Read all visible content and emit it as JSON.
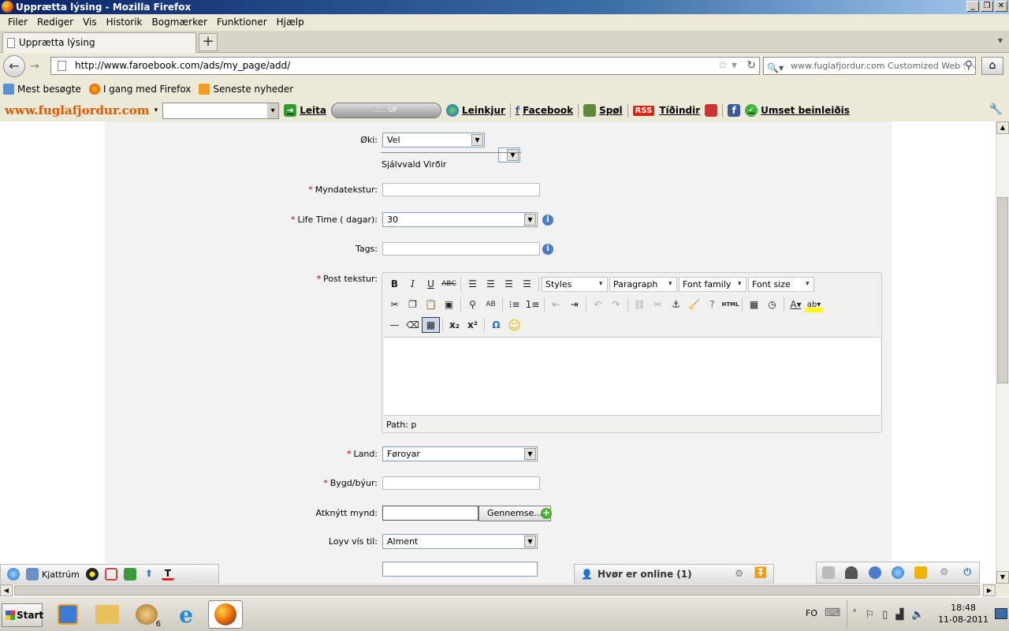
{
  "window": {
    "title": "Upprætta lýsing - Mozilla Firefox"
  },
  "menu": {
    "items": [
      "Filer",
      "Rediger",
      "Vis",
      "Historik",
      "Bogmærker",
      "Funktioner",
      "Hjælp"
    ]
  },
  "tab": {
    "title": "Upprætta lýsing"
  },
  "nav": {
    "url": "http://www.faroebook.com/ads/my_page/add/",
    "search_text": "www.fuglafjordur.com Customized Web Sear"
  },
  "bookmarks": [
    "Mest besøgte",
    "I gang med Firefox",
    "Seneste nyheder"
  ],
  "custom_toolbar": {
    "brand": "www.fuglafjordur.com",
    "search_button": "Leita",
    "player_text": "..... UF",
    "links_button": "Leinkjur",
    "facebook_button": "Facebook",
    "games_button": "Spøl",
    "rss_badge": "RSS",
    "news_button": "Tíðindir",
    "misc_button": "Umset beinleiðis"
  },
  "form": {
    "area_label": "Øki:",
    "area_value": "Vel",
    "optional_note": "Sjálvvald Virðir",
    "caption_label": "Myndatekstur:",
    "lifetime_label": "Life Time ( dagar):",
    "lifetime_value": "30",
    "tags_label": "Tags:",
    "post_label": "Post tekstur:",
    "country_label": "Land:",
    "country_value": "Føroyar",
    "town_label": "Bygd/býur:",
    "image_label": "Atknýtt mynd:",
    "browse_button": "Gennemse...",
    "visibility_label": "Loyv vís til:",
    "visibility_value": "Alment"
  },
  "editor": {
    "styles": "Styles",
    "paragraph": "Paragraph",
    "font_family": "Font family",
    "font_size": "Font size",
    "path": "Path: p"
  },
  "sitebar": {
    "chat": "Kjattrúm",
    "online": "Hvør er online (1)"
  },
  "taskbar": {
    "start": "Start",
    "group_count": "6",
    "lang": "FO",
    "time": "18:48",
    "date": "11-08-2011"
  }
}
